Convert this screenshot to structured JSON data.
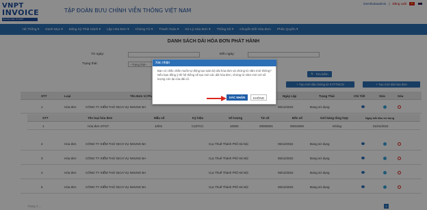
{
  "header": {
    "logo_top": "VNPT",
    "logo_bottom": "INVOICE",
    "logo_tag": "Hóa đơn điện tử VNPT",
    "company": "TẬP ĐOÀN BƯU CHÍNH VIỄN THÔNG VIỆT NAM",
    "user": "kiemthubaadmin",
    "logout": "Đăng xuất"
  },
  "nav": [
    "Hệ Thống ▾",
    "Danh Mục ▾",
    "Đăng Ký Phát Hành ▾",
    "Lập Hóa Đơn ▾",
    "Chứng Từ ▾",
    "Thanh Toán ▾",
    "Xử Lý Hóa Đơn ▾",
    "Thống Kê ▾",
    "Chuyển Đổi Hóa Đơn",
    "Phân Quyền ▾"
  ],
  "page_title": "DANH SÁCH DẢI HÓA ĐƠN PHÁT HÀNH",
  "filter": {
    "from_label": "Từ ngày:",
    "to_label": "Đến ngày:",
    "status_label": "Trạng thái:",
    "status_value": "--Trạng thái--",
    "search_btn": "🔍 Tìm kiếm",
    "add_ktt_btn": "+ Tạo mới dải chứng từ KTTTNCN",
    "add_btn": "+ Tạo mới dải hóa đơn"
  },
  "table": {
    "headers": [
      "STT",
      "Loại",
      "Tên Đơn Vị Phát Hành",
      "Ngày Lập",
      "Trạng Thái",
      "Chi Tiết",
      "Sửa",
      "Xóa"
    ],
    "rows": [
      {
        "stt": "1",
        "loai": "Hóa đơn",
        "unit": "CÔNG TY KIỂM THỬ DỊCH VỤ NHUNG BA",
        "tax": "",
        "date": "06/12/2022",
        "status": "Đang sử dụng"
      },
      {
        "stt": "2",
        "loai": "Hóa đơn",
        "unit": "CÔNG TY KIỂM THỬ DỊCH VỤ NHUNG BA",
        "tax": "Cục Thuế Thành Phố Hà Nội",
        "date": "06/12/2022",
        "status": "Đang sử dụng"
      },
      {
        "stt": "3",
        "loai": "Hóa đơn",
        "unit": "CÔNG TY KIỂM THỬ DỊCH VỤ NHUNG BA",
        "tax": "Cục Thuế Thành Phố Hà Nội",
        "date": "06/12/2022",
        "status": "Đang sử dụng"
      },
      {
        "stt": "4",
        "loai": "Hóa đơn",
        "unit": "CÔNG TY KIỂM THỬ DỊCH VỤ NHUNG BA",
        "tax": "Cục Thuế Thành Phố Hà Nội",
        "date": "06/12/2022",
        "status": "Đang sử dụng"
      },
      {
        "stt": "5",
        "loai": "Hóa đơn",
        "unit": "CÔNG TY KIỂM THỬ DỊCH VỤ NHUNG BA",
        "tax": "Cục Thuế Thành Phố Hà Nội",
        "date": "06/12/2022",
        "status": "Đang sử dụng"
      }
    ],
    "sub_headers": [
      "STT",
      "Tên loại hóa đơn",
      "Mẫu số",
      "Ký hiệu",
      "Số lượng",
      "Từ số",
      "Đến số",
      "Gởi bảng tổng hợp",
      "Ngày bắt đầu sử dụng"
    ],
    "sub_row": [
      "1",
      "Hóa đơn GTGT",
      "1/001",
      "C22TCC",
      "10000",
      "00000001",
      "00010000",
      "Không",
      "01/01/2022"
    ]
  },
  "dialog": {
    "title": "Xác nhận",
    "message": "Bạn có chắc chắn muốn tự động tạo toàn bộ dải hóa đơn và chứng từ năm mới không? Nếu bạn đồng ý thì hệ thống sẽ tạo mới các dải hóa đơn, chứng từ năm mới với số lượng còn lại của dải cũ.",
    "confirm": "XÁC NHẬN",
    "cancel": "KHÔNG"
  },
  "pager": {
    "left": "Trang 1 ...",
    "current": "1"
  },
  "colors": {
    "primary": "#2d6fb5",
    "nav": "#2d6fb5",
    "arrow": "#d9261c"
  }
}
